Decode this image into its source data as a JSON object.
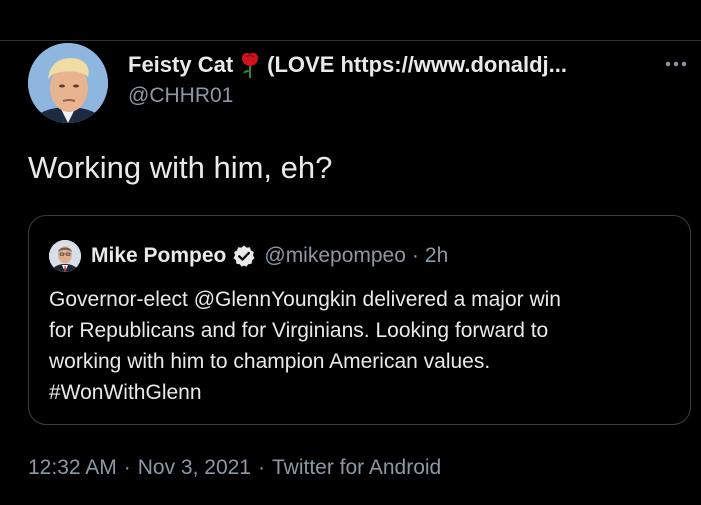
{
  "tweet": {
    "author_name": "Feisty Cat",
    "author_name_suffix": "(LOVE https://www.donaldj...",
    "author_handle": "@CHHR01",
    "text": "Working with him, eh?",
    "icons": {
      "more": "more-horizontal-icon",
      "rose": "rose-icon"
    }
  },
  "quote": {
    "author_name": "Mike Pompeo",
    "author_handle": "@mikepompeo",
    "separator": "·",
    "time": "2h",
    "lines": [
      "Governor-elect @GlennYoungkin delivered a major win",
      "for Republicans and for Virginians. Looking forward to",
      "working with him to champion American values.",
      "#WonWithGlenn"
    ],
    "icons": {
      "verified": "verified-badge-icon"
    }
  },
  "meta": {
    "time": "12:32 AM",
    "separator": "·",
    "date": "Nov 3, 2021",
    "source": "Twitter for Android"
  },
  "colors": {
    "background": "#000000",
    "primary_text": "#e7e9ea",
    "secondary_text": "#8b98a5",
    "border": "#3a3f44",
    "rose": "#d0121b"
  }
}
